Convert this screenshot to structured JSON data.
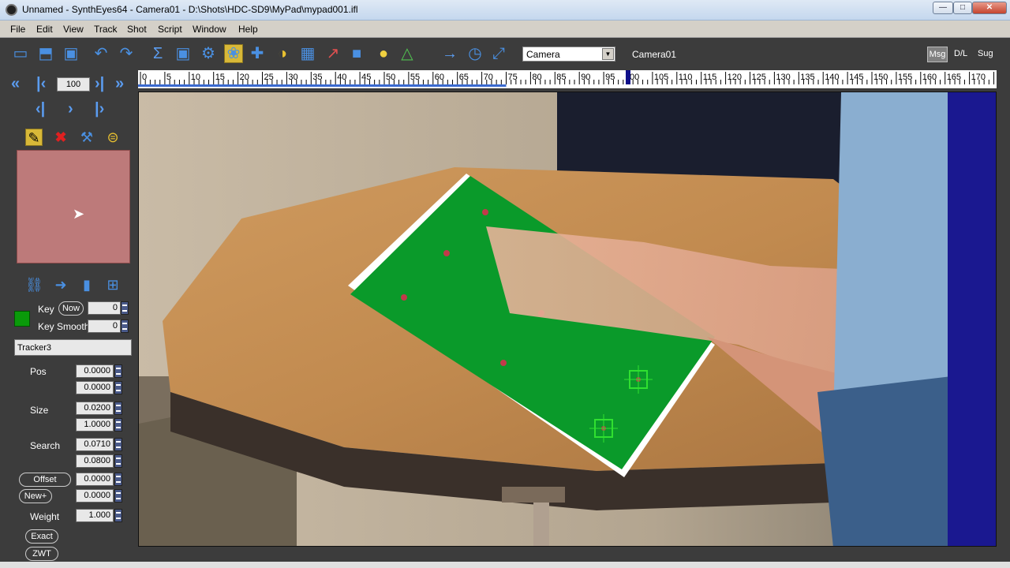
{
  "window": {
    "title": "Unnamed - SynthEyes64 - Camera01 - D:\\Shots\\HDC-SD9\\MyPad\\mypad001.ifl",
    "min": "—",
    "max": "□",
    "close": "✕"
  },
  "menu": [
    "File",
    "Edit",
    "View",
    "Track",
    "Shot",
    "Script",
    "Window",
    "Help"
  ],
  "toolbar": {
    "icons": [
      {
        "name": "new-file-icon",
        "glyph": "▭",
        "color": "#4a90e2"
      },
      {
        "name": "open-folder-icon",
        "glyph": "⬒",
        "color": "#4a90e2"
      },
      {
        "name": "save-icon",
        "glyph": "▣",
        "color": "#4a90e2"
      },
      {
        "name": "undo-icon",
        "glyph": "↶",
        "color": "#4a90e2"
      },
      {
        "name": "redo-icon",
        "glyph": "↷",
        "color": "#4a90e2"
      },
      {
        "name": "sigma-icon",
        "glyph": "Σ",
        "color": "#5b9cf0"
      },
      {
        "name": "camera-solver-icon",
        "glyph": "▣",
        "color": "#4a90e2"
      },
      {
        "name": "gear-icon",
        "glyph": "⚙",
        "color": "#4a90e2"
      },
      {
        "name": "paw-icon",
        "glyph": "❀",
        "color": "#4a90e2"
      },
      {
        "name": "coordinate-icon",
        "glyph": "✚",
        "color": "#4a90e2"
      },
      {
        "name": "lens-icon",
        "glyph": "◑",
        "color": "#e8c030"
      },
      {
        "name": "calculator-icon",
        "glyph": "▦",
        "color": "#4a90e2"
      },
      {
        "name": "graph-icon",
        "glyph": "↗",
        "color": "#e05050"
      },
      {
        "name": "cube-icon",
        "glyph": "■",
        "color": "#4a90e2"
      },
      {
        "name": "lightbulb-icon",
        "glyph": "●",
        "color": "#f0d040"
      },
      {
        "name": "triangle-icon",
        "glyph": "△",
        "color": "#50c050"
      },
      {
        "name": "arrow-right-icon",
        "glyph": "→",
        "color": "#5b9cf0"
      },
      {
        "name": "clock-icon",
        "glyph": "◷",
        "color": "#4a90e2"
      },
      {
        "name": "expand-icon",
        "glyph": "⤢",
        "color": "#4a90e2"
      }
    ],
    "active_icon": "paw-icon",
    "camera_select": "Camera",
    "camera_name": "Camera01",
    "msg": "Msg",
    "dl": "D/L",
    "sug": "Sug"
  },
  "navigation": {
    "frame": "100"
  },
  "timebar": {
    "ticks": [
      "0",
      "5",
      "10",
      "15",
      "20",
      "25",
      "30",
      "35",
      "40",
      "45",
      "50",
      "55",
      "60",
      "65",
      "70",
      "75",
      "80",
      "85",
      "90",
      "95",
      "00",
      "105",
      "110",
      "115",
      "120",
      "125",
      "130",
      "135",
      "140",
      "145",
      "150",
      "155",
      "160",
      "165",
      "170"
    ],
    "current_frame": 100
  },
  "tracker": {
    "key_label": "Key",
    "key_now": "Now",
    "key_value": "0",
    "key_smooth_label": "Key Smooth",
    "key_smooth_value": "0",
    "name": "Tracker3",
    "pos_label": "Pos",
    "pos_x": "0.0000",
    "pos_y": "0.0000",
    "size_label": "Size",
    "size_a": "0.0200",
    "size_b": "1.0000",
    "search_label": "Search",
    "search_a": "0.0710",
    "search_b": "0.0800",
    "offset_label": "Offset",
    "offset_value": "0.0000",
    "new_label": "New+",
    "new_value": "0.0000",
    "weight_label": "Weight",
    "weight_value": "1.000",
    "exact_label": "Exact",
    "zwt_label": "ZWT",
    "swatch_color": "#0a9a0a"
  }
}
